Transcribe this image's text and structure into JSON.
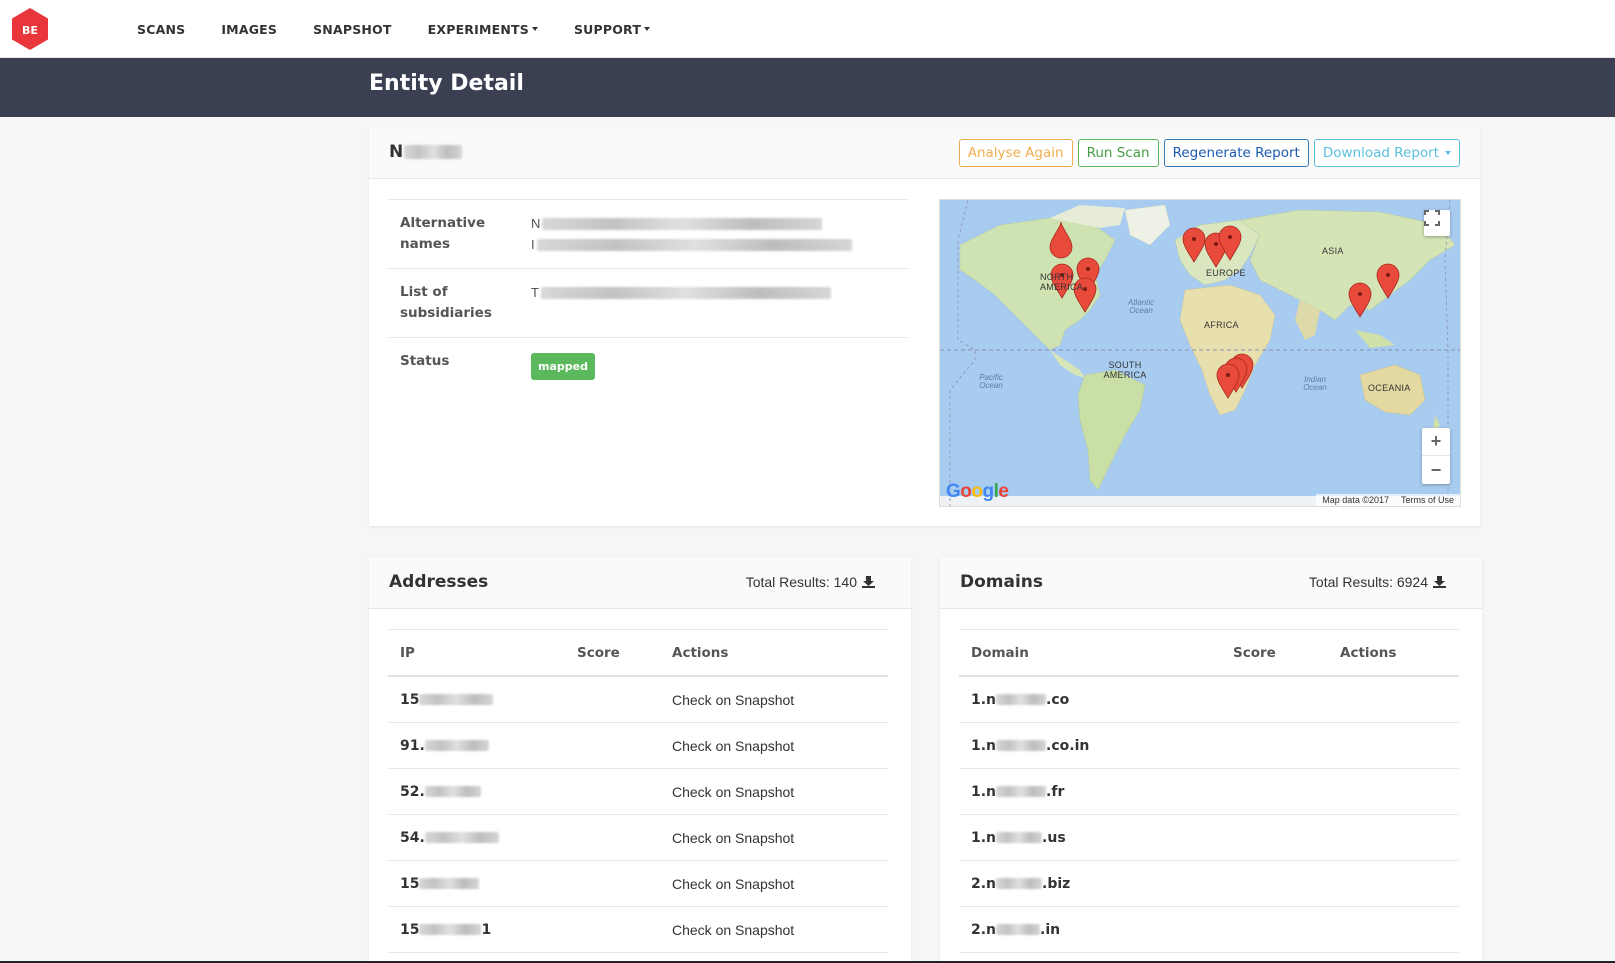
{
  "nav": {
    "logo_text": "BE",
    "items": [
      {
        "label": "SCANS",
        "dropdown": false
      },
      {
        "label": "IMAGES",
        "dropdown": false
      },
      {
        "label": "SNAPSHOT",
        "dropdown": false
      },
      {
        "label": "EXPERIMENTS",
        "dropdown": true
      },
      {
        "label": "SUPPORT",
        "dropdown": true
      }
    ]
  },
  "page": {
    "title": "Entity Detail"
  },
  "entity": {
    "name_visible": "N",
    "buttons": {
      "analyse": "Analyse Again",
      "run_scan": "Run Scan",
      "regenerate": "Regenerate Report",
      "download": "Download Report"
    },
    "fields": {
      "alt_names_label": "Alternative names",
      "alt_names_prefix_1": "N",
      "alt_names_prefix_2": "I",
      "subsidiaries_label": "List of subsidiaries",
      "subsidiaries_prefix": "T",
      "status_label": "Status",
      "status_value": "mapped"
    }
  },
  "map": {
    "labels": {
      "asia": "ASIA",
      "europe": "EUROPE",
      "africa": "AFRICA",
      "north_america": "NORTH AMERICA",
      "south_america": "SOUTH AMERICA",
      "oceania": "OCEANIA",
      "atlantic": "Atlantic Ocean",
      "pacific": "Pacific Ocean",
      "indian": "Indian Ocean"
    },
    "google": "Google",
    "attribution": "Map data ©2017",
    "terms": "Terms of Use",
    "zoom_in": "+",
    "zoom_out": "−",
    "pin_color": "#e84a3b"
  },
  "addresses": {
    "title": "Addresses",
    "total_label": "Total Results: 140",
    "columns": [
      "IP",
      "Score",
      "Actions"
    ],
    "rows": [
      {
        "ip_prefix": "15",
        "action": "Check on Snapshot"
      },
      {
        "ip_prefix": "91.",
        "action": "Check on Snapshot"
      },
      {
        "ip_prefix": "52.",
        "action": "Check on Snapshot"
      },
      {
        "ip_prefix": "54.",
        "action": "Check on Snapshot"
      },
      {
        "ip_prefix": "15",
        "action": "Check on Snapshot"
      },
      {
        "ip_prefix": "15",
        "ip_suffix": "1",
        "action": "Check on Snapshot"
      }
    ]
  },
  "domains": {
    "title": "Domains",
    "total_label": "Total Results: 6924",
    "columns": [
      "Domain",
      "Score",
      "Actions"
    ],
    "rows": [
      {
        "prefix": "1.n",
        "suffix": ".co"
      },
      {
        "prefix": "1.n",
        "suffix": ".co.in"
      },
      {
        "prefix": "1.n",
        "suffix": ".fr"
      },
      {
        "prefix": "1.n",
        "suffix": ".us"
      },
      {
        "prefix": "2.n",
        "suffix": ".biz"
      },
      {
        "prefix": "2.n",
        "suffix": ".in"
      }
    ]
  }
}
